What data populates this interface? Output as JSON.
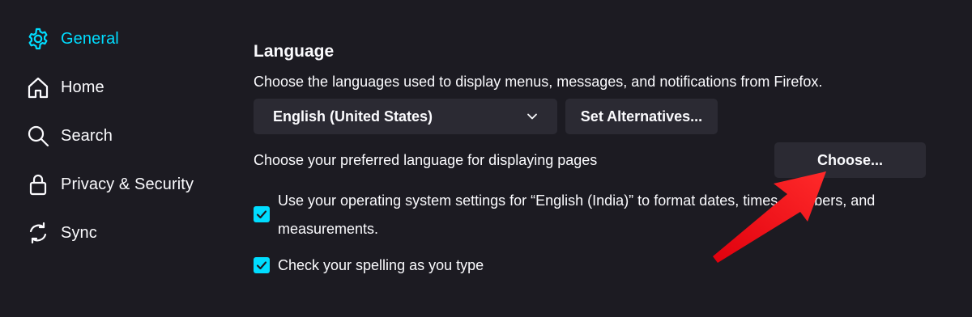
{
  "sidebar": {
    "items": [
      {
        "label": "General",
        "icon": "gear-icon",
        "active": true
      },
      {
        "label": "Home",
        "icon": "home-icon",
        "active": false
      },
      {
        "label": "Search",
        "icon": "search-icon",
        "active": false
      },
      {
        "label": "Privacy & Security",
        "icon": "lock-icon",
        "active": false
      },
      {
        "label": "Sync",
        "icon": "sync-icon",
        "active": false
      }
    ]
  },
  "language": {
    "heading": "Language",
    "description": "Choose the languages used to display menus, messages, and notifications from Firefox.",
    "selected_language": "English (United States)",
    "set_alternatives_label": "Set Alternatives...",
    "preferred_text": "Choose your preferred language for displaying pages",
    "choose_label": "Choose...",
    "os_settings_line1": "Use your operating system settings for “English (India)” to format dates, times, numbers, and",
    "os_settings_line2": "measurements.",
    "spelling_label": "Check your spelling as you type"
  },
  "checkboxes": {
    "os_settings_checked": true,
    "spelling_checked": true
  },
  "colors": {
    "background": "#1c1b22",
    "accent": "#00ddff",
    "button_bg": "#2b2a33",
    "text": "#fbfbfe",
    "annotation_arrow": "#ff1a1a"
  }
}
